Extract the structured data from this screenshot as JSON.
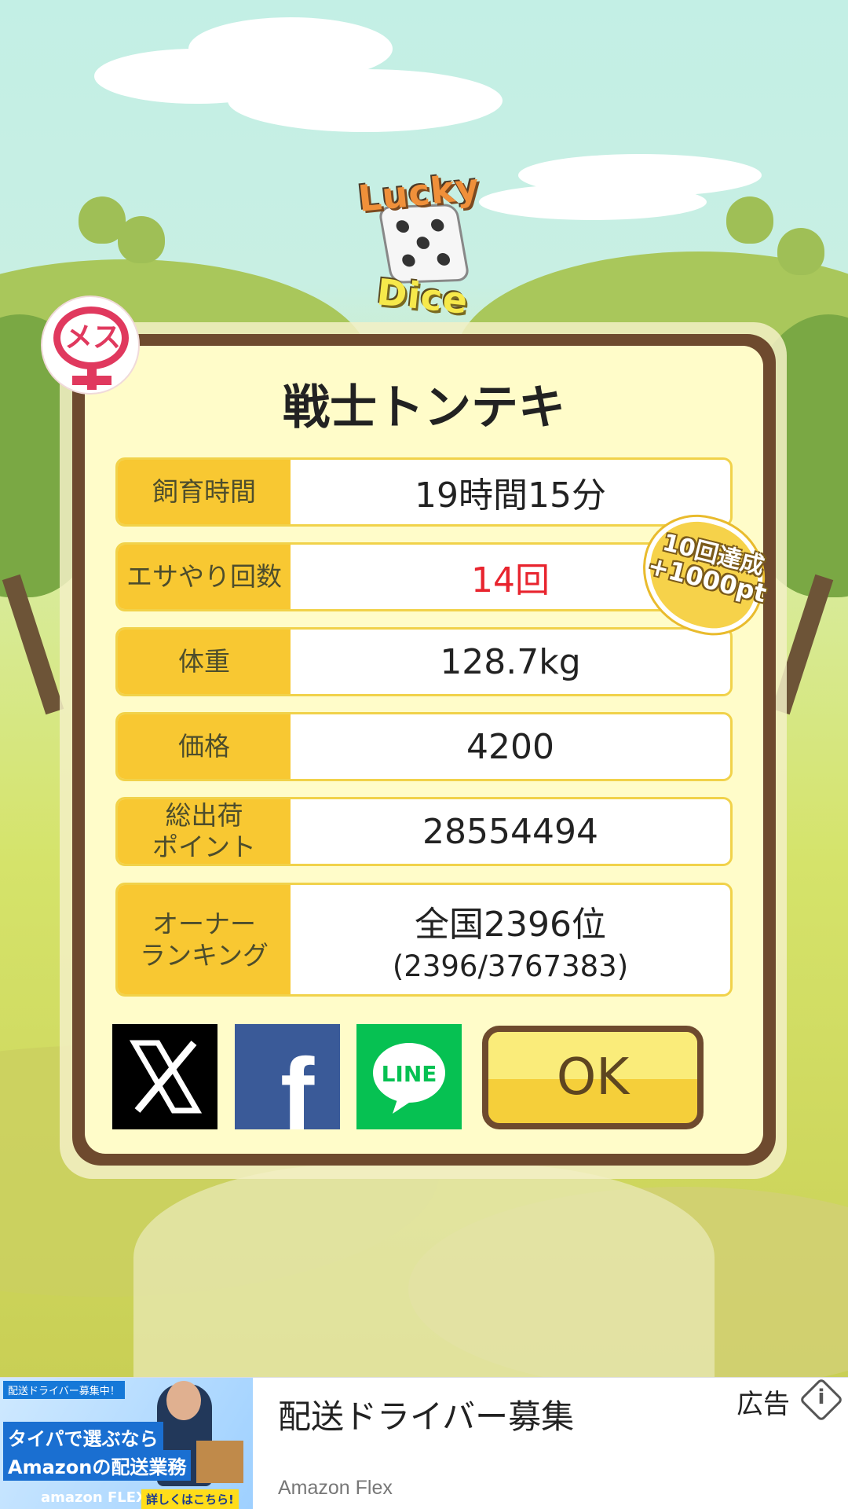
{
  "app": {
    "logo_line1": "Lucky",
    "logo_line2": "Dice"
  },
  "pig": {
    "gender_label": "メス",
    "name": "戦士トンテキ",
    "stats": [
      {
        "label": "飼育時間",
        "value": "19時間15分"
      },
      {
        "label": "エサやり回数",
        "value": "14回"
      },
      {
        "label": "体重",
        "value": "128.7kg"
      },
      {
        "label": "価格",
        "value": "4200"
      },
      {
        "label": "総出荷\nポイント",
        "value": "28554494"
      },
      {
        "label": "オーナー\nランキング",
        "value": "全国2396位",
        "sub": "(2396/3767383)"
      }
    ],
    "bonus_badge": {
      "line1": "10回達成",
      "line2": "+1000pt"
    },
    "highlight_color": "#e8242e"
  },
  "actions": {
    "share_x": "X",
    "share_facebook": "f",
    "share_line": "LINE",
    "ok": "OK"
  },
  "ad": {
    "image_recruit": "配送ドライバー募集中！",
    "image_line1": "タイパで選ぶなら",
    "image_line2": "Amazonの配送業務",
    "image_brand": "amazon FLEX",
    "image_cta": "詳しくはこちら!",
    "title": "配送ドライバー募集",
    "advertiser": "Amazon Flex",
    "label": "広告",
    "info_icon": "i"
  }
}
